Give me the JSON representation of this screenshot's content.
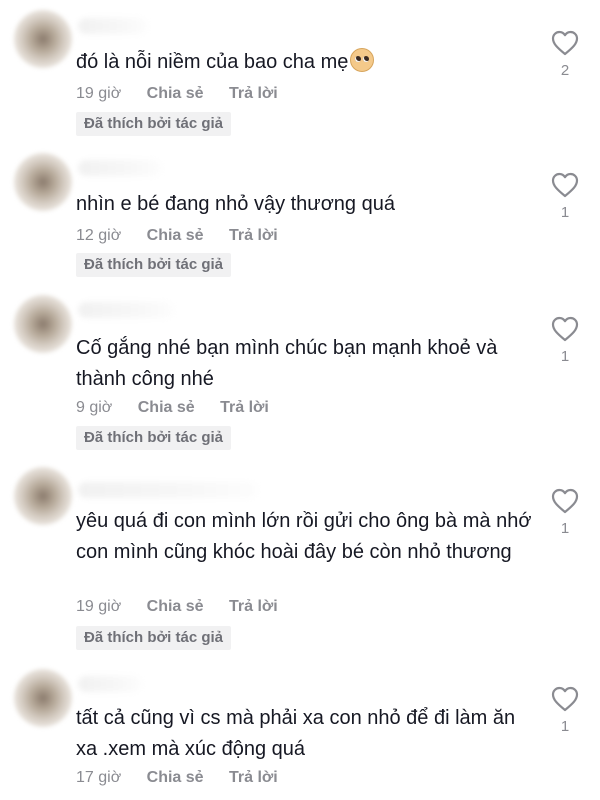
{
  "comments": [
    {
      "text": "đó là nỗi niềm của bao cha mẹ",
      "emoji_icon": "pleading-face-emoji",
      "time": "19 giờ",
      "share_label": "Chia sẻ",
      "reply_label": "Trả lời",
      "liked_by_author": "Đã thích bởi tác giả",
      "like_count": "2"
    },
    {
      "text": "nhìn e bé đang nhỏ vậy thương quá",
      "time": "12 giờ",
      "share_label": "Chia sẻ",
      "reply_label": "Trả lời",
      "liked_by_author": "Đã thích bởi tác giả",
      "like_count": "1"
    },
    {
      "text": "Cố gắng nhé bạn mình chúc bạn mạnh khoẻ và thành công nhé",
      "time": "9 giờ",
      "share_label": "Chia sẻ",
      "reply_label": "Trả lời",
      "liked_by_author": "Đã thích bởi tác giả",
      "like_count": "1"
    },
    {
      "text": "yêu quá đi con mình lớn rồi gửi cho ông bà mà nhớ con mình cũng khóc hoài đây bé còn nhỏ thương",
      "time": "19 giờ",
      "share_label": "Chia sẻ",
      "reply_label": "Trả lời",
      "liked_by_author": "Đã thích bởi tác giả",
      "like_count": "1"
    },
    {
      "text": "tất cả cũng vì cs mà phải xa con nhỏ để đi làm ăn xa .xem mà xúc động quá",
      "time": "17 giờ",
      "share_label": "Chia sẻ",
      "reply_label": "Trả lời",
      "like_count": "1"
    }
  ],
  "colors": {
    "text": "#161823",
    "meta": "#8a8b91",
    "badge_bg": "#f1f1f2",
    "heart_outline": "#8a8b91"
  },
  "icons": {
    "like": "heart-outline-icon"
  }
}
